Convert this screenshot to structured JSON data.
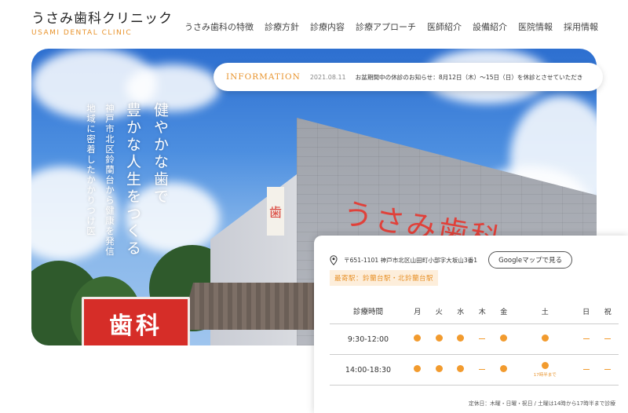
{
  "header": {
    "logo_jp": "うさみ歯科クリニック",
    "logo_en": "USAMI DENTAL CLINIC",
    "nav": [
      "うさみ歯科の特徴",
      "診療方針",
      "診療内容",
      "診療アプローチ",
      "医師紹介",
      "設備紹介",
      "医院情報",
      "採用情報"
    ]
  },
  "hero": {
    "tagline_main": [
      "健やかな歯で",
      "豊かな人生をつくる"
    ],
    "tagline_sub": [
      "神戸市北区鈴蘭台から健康を発信",
      "地域に密着したかかりつけ医"
    ],
    "building_sign": "うさみ歯科",
    "building_vsign": "歯",
    "street_sign": "歯科"
  },
  "info": {
    "label": "INFORMATION",
    "date": "2021.08.11",
    "text": "お盆期間中の休診のお知らせ：8月12日（木）〜15日（日）を休診とさせていただき"
  },
  "schedule": {
    "address": "〒651-1101 神戸市北区山田町小部字大坂山3番1",
    "map_button": "Googleマップで見る",
    "station": "最寄駅：鈴蘭台駅・北鈴蘭台駅",
    "header": [
      "診療時間",
      "月",
      "火",
      "水",
      "木",
      "金",
      "土",
      "日",
      "祝"
    ],
    "rows": [
      {
        "time": "9:30-12:00",
        "cells": [
          "dot",
          "dot",
          "dot",
          "dash",
          "dot",
          "dot",
          "dash",
          "dash"
        ]
      },
      {
        "time": "14:00-18:30",
        "cells": [
          "dot",
          "dot",
          "dot",
          "dash",
          "dot",
          "dot",
          "dash",
          "dash"
        ],
        "sat_note": "17時半まで"
      }
    ],
    "note": "定休日：木曜・日曜・祝日 / 土曜は14時から17時半まで診療"
  },
  "colors": {
    "accent": "#e8932c",
    "dot": "#f29b2e",
    "sign_red": "#d62d28"
  }
}
